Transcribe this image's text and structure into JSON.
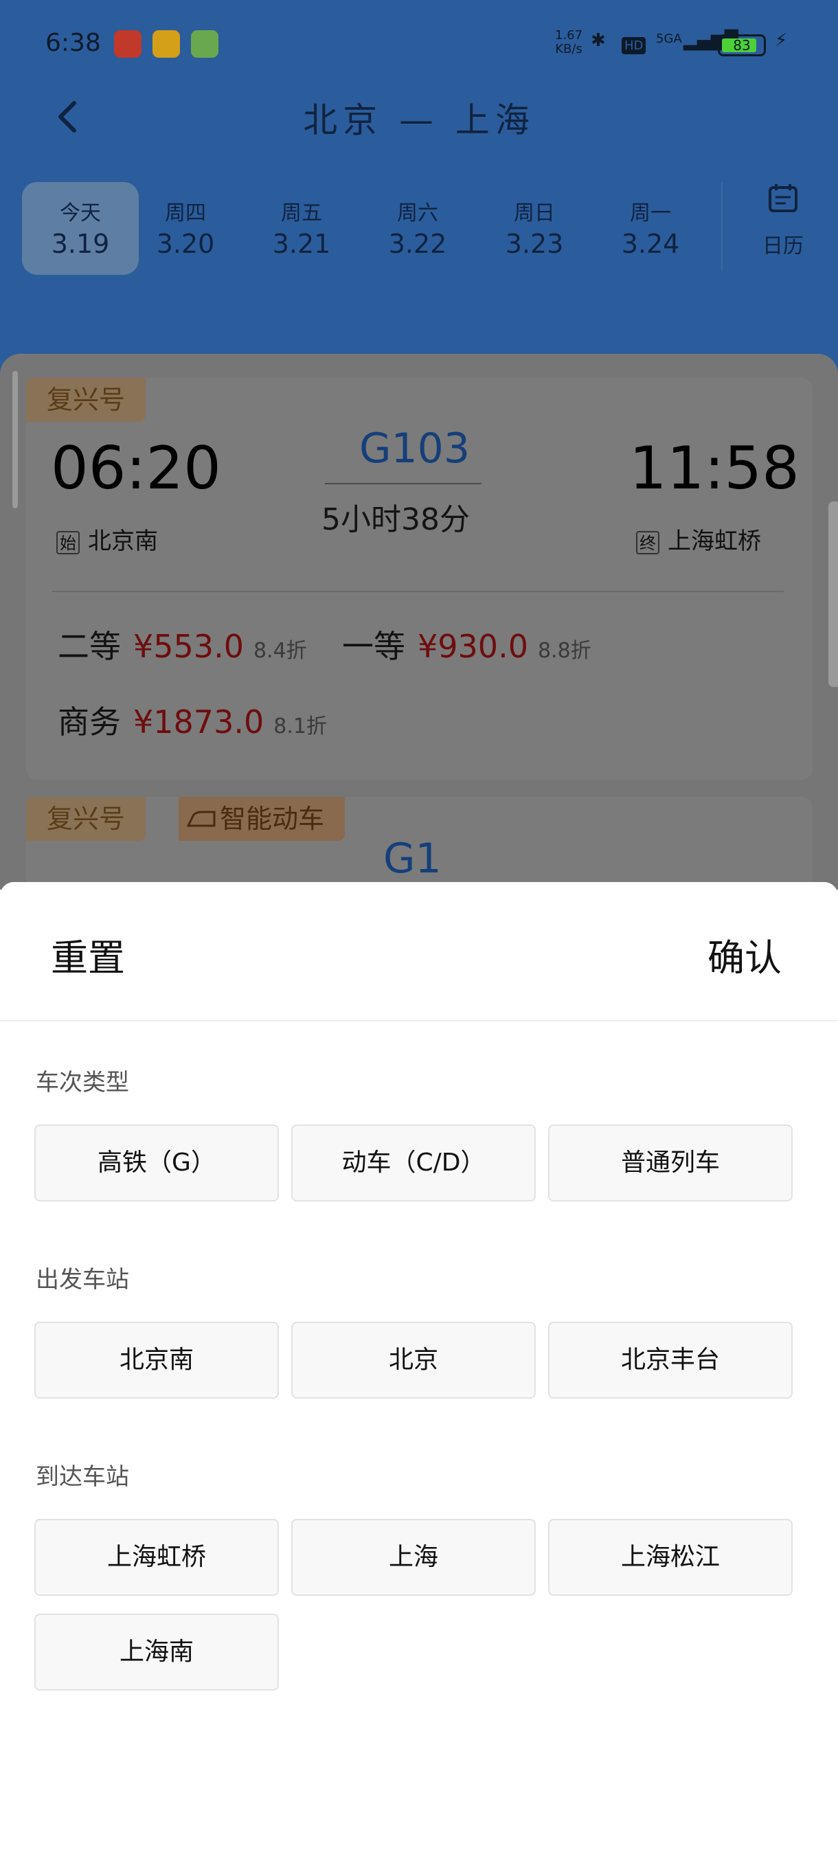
{
  "status_bar": {
    "time": "6:38",
    "net_speed_value": "1.67",
    "net_speed_unit": "KB/s",
    "network": "5GA",
    "hd": "HD",
    "battery": "83"
  },
  "header": {
    "title": "北京 — 上海",
    "date_tabs": [
      {
        "weekday": "今天",
        "date": "3.19"
      },
      {
        "weekday": "周四",
        "date": "3.20"
      },
      {
        "weekday": "周五",
        "date": "3.21"
      },
      {
        "weekday": "周六",
        "date": "3.22"
      },
      {
        "weekday": "周日",
        "date": "3.23"
      },
      {
        "weekday": "周一",
        "date": "3.24"
      }
    ],
    "calendar_label": "日历"
  },
  "results": [
    {
      "badge": "复兴号",
      "train_no": "G103",
      "depart_time": "06:20",
      "arrive_time": "11:58",
      "duration": "5小时38分",
      "depart_tag": "始",
      "depart_station": "北京南",
      "arrive_tag": "终",
      "arrive_station": "上海虹桥",
      "seats": [
        {
          "class": "二等",
          "price": "¥553.0",
          "discount": "8.4折"
        },
        {
          "class": "一等",
          "price": "¥930.0",
          "discount": "8.8折"
        },
        {
          "class": "商务",
          "price": "¥1873.0",
          "discount": "8.1折"
        }
      ]
    },
    {
      "badge": "复兴号",
      "badge2": "智能动车",
      "train_no": "G1"
    }
  ],
  "filter_sheet": {
    "reset_label": "重置",
    "confirm_label": "确认",
    "sections": [
      {
        "title": "车次类型",
        "options": [
          "高铁（G）",
          "动车（C/D）",
          "普通列车"
        ]
      },
      {
        "title": "出发车站",
        "options": [
          "北京南",
          "北京",
          "北京丰台"
        ]
      },
      {
        "title": "到达车站",
        "options": [
          "上海虹桥",
          "上海",
          "上海松江",
          "上海南"
        ]
      }
    ]
  },
  "colors": {
    "header_bg": "#2b5d9c",
    "price": "#c80000",
    "train_no": "#1a5bb5",
    "badge": "#f0c38a"
  }
}
